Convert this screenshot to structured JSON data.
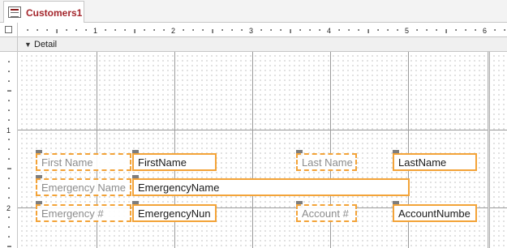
{
  "tab": {
    "title": "Customers1",
    "icon": "form-icon"
  },
  "ruler": {
    "numbers": [
      "1",
      "2",
      "3",
      "4",
      "5",
      "6"
    ],
    "vertical_numbers": [
      "1",
      "2"
    ]
  },
  "section": {
    "label": "Detail",
    "icon": "section-arrow-icon"
  },
  "controls": {
    "first_name_label": "First Name",
    "first_name_box": "FirstName",
    "last_name_label": "Last Name",
    "last_name_box": "LastName",
    "emergency_name_label": "Emergency Name",
    "emergency_name_box": "EmergencyName",
    "emergency_num_label": "Emergency #",
    "emergency_num_box": "EmergencyNun",
    "account_label": "Account #",
    "account_box": "AccountNumbe"
  },
  "colors": {
    "selection": "#f3a338",
    "handle": "#7d7d7d",
    "tab_text": "#a4262c"
  }
}
